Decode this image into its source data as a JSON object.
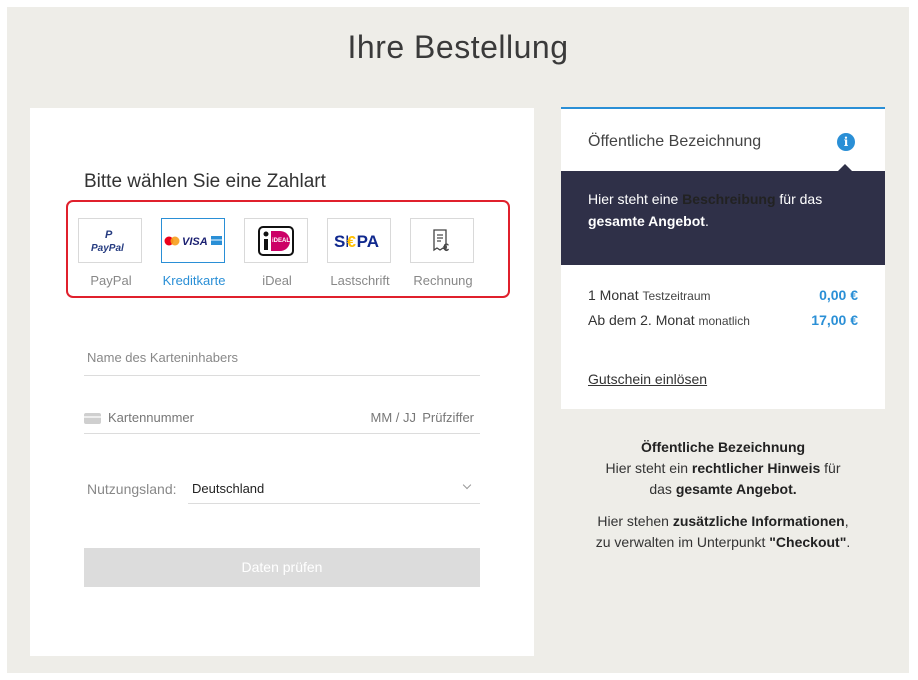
{
  "page": {
    "title": "Ihre Bestellung"
  },
  "payment": {
    "heading": "Bitte wählen Sie eine Zahlart",
    "methods": [
      {
        "label": "PayPal",
        "logo": "PayPal"
      },
      {
        "label": "Kreditkarte",
        "logo": "VISA"
      },
      {
        "label": "iDeal",
        "logo": "iDEAL"
      },
      {
        "label": "Lastschrift",
        "logo": "SEPA"
      },
      {
        "label": "Rechnung",
        "logo": "€"
      }
    ],
    "selected": "Kreditkarte",
    "highlight_color": "#e0202c"
  },
  "form": {
    "cardholder_placeholder": "Name des Karteninhabers",
    "card_number_placeholder": "Kartennummer",
    "expiry_placeholder": "MM / JJ",
    "cvc_placeholder": "Prüfziffer",
    "country_label": "Nutzungsland:",
    "country_value": "Deutschland",
    "submit_label": "Daten prüfen"
  },
  "summary": {
    "title": "Öffentliche Bezeichnung",
    "desc_pre": "Hier steht eine ",
    "desc_bold1": "Beschreibung",
    "desc_mid": " für das ",
    "desc_bold2": "gesamte Angebot",
    "desc_post": ".",
    "rows": [
      {
        "label": "1 Monat",
        "sub": "Testzeitraum",
        "amount": "0,00 €"
      },
      {
        "label": "Ab dem 2. Monat",
        "sub": "monatlich",
        "amount": "17,00 €"
      }
    ],
    "voucher": "Gutschein einlösen",
    "accent_color": "#2a8fd6",
    "band_color": "#2f3048"
  },
  "legal": {
    "title": "Öffentliche Bezeichnung",
    "l2_pre": "Hier steht ein ",
    "l2_bold": "rechtlicher Hinweis",
    "l2_post": " für",
    "l3_pre": "das ",
    "l3_bold": "gesamte Angebot.",
    "l4_pre": "Hier stehen ",
    "l4_bold": "zusätzliche Informationen",
    "l4_post": ",",
    "l5_pre": "zu verwalten im Unterpunkt ",
    "l5_bold": "\"Checkout\"",
    "l5_post": "."
  }
}
